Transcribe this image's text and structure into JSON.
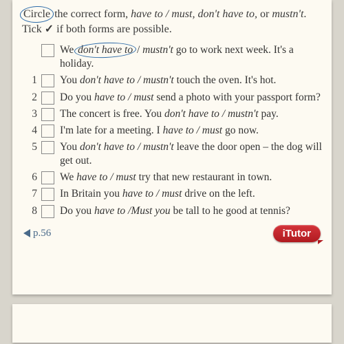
{
  "instructions": {
    "circled_word": "Circle",
    "after_circle": " the correct form, ",
    "forms": "have to / must, don't have to,",
    "or": " or ",
    "mustnt": "mustn't",
    "tail": ". Tick ",
    "tick": "✓",
    "tail2": " if both forms are possible."
  },
  "example": {
    "pre": "We ",
    "circled": "don't have to",
    "mid": " / ",
    "alt": "mustn't",
    "post": " go to work next week. It's a holiday."
  },
  "items": [
    {
      "n": "1",
      "pre": "You ",
      "a": "don't have to / mustn't",
      "post": " touch the oven. It's hot."
    },
    {
      "n": "2",
      "pre": "Do you ",
      "a": "have to / must",
      "post": " send a photo with your passport form?"
    },
    {
      "n": "3",
      "pre": "The concert is free. You ",
      "a": "don't have to / mustn't",
      "post": " pay."
    },
    {
      "n": "4",
      "pre": "I'm late for a meeting. I ",
      "a": "have to / must",
      "post": " go now."
    },
    {
      "n": "5",
      "pre": "You ",
      "a": "don't have to / mustn't",
      "post": " leave the door open – the dog will get out."
    },
    {
      "n": "6",
      "pre": "We ",
      "a": "have to / must",
      "post": " try that new restaurant in town."
    },
    {
      "n": "7",
      "pre": "In Britain you ",
      "a": "have to / must",
      "post": " drive on the left."
    },
    {
      "n": "8",
      "pre": "Do you ",
      "a": "have to /Must you",
      "post": " be tall to he good at tennis?"
    }
  ],
  "footer": {
    "pageref": "p.56",
    "itutor": "iTutor"
  }
}
